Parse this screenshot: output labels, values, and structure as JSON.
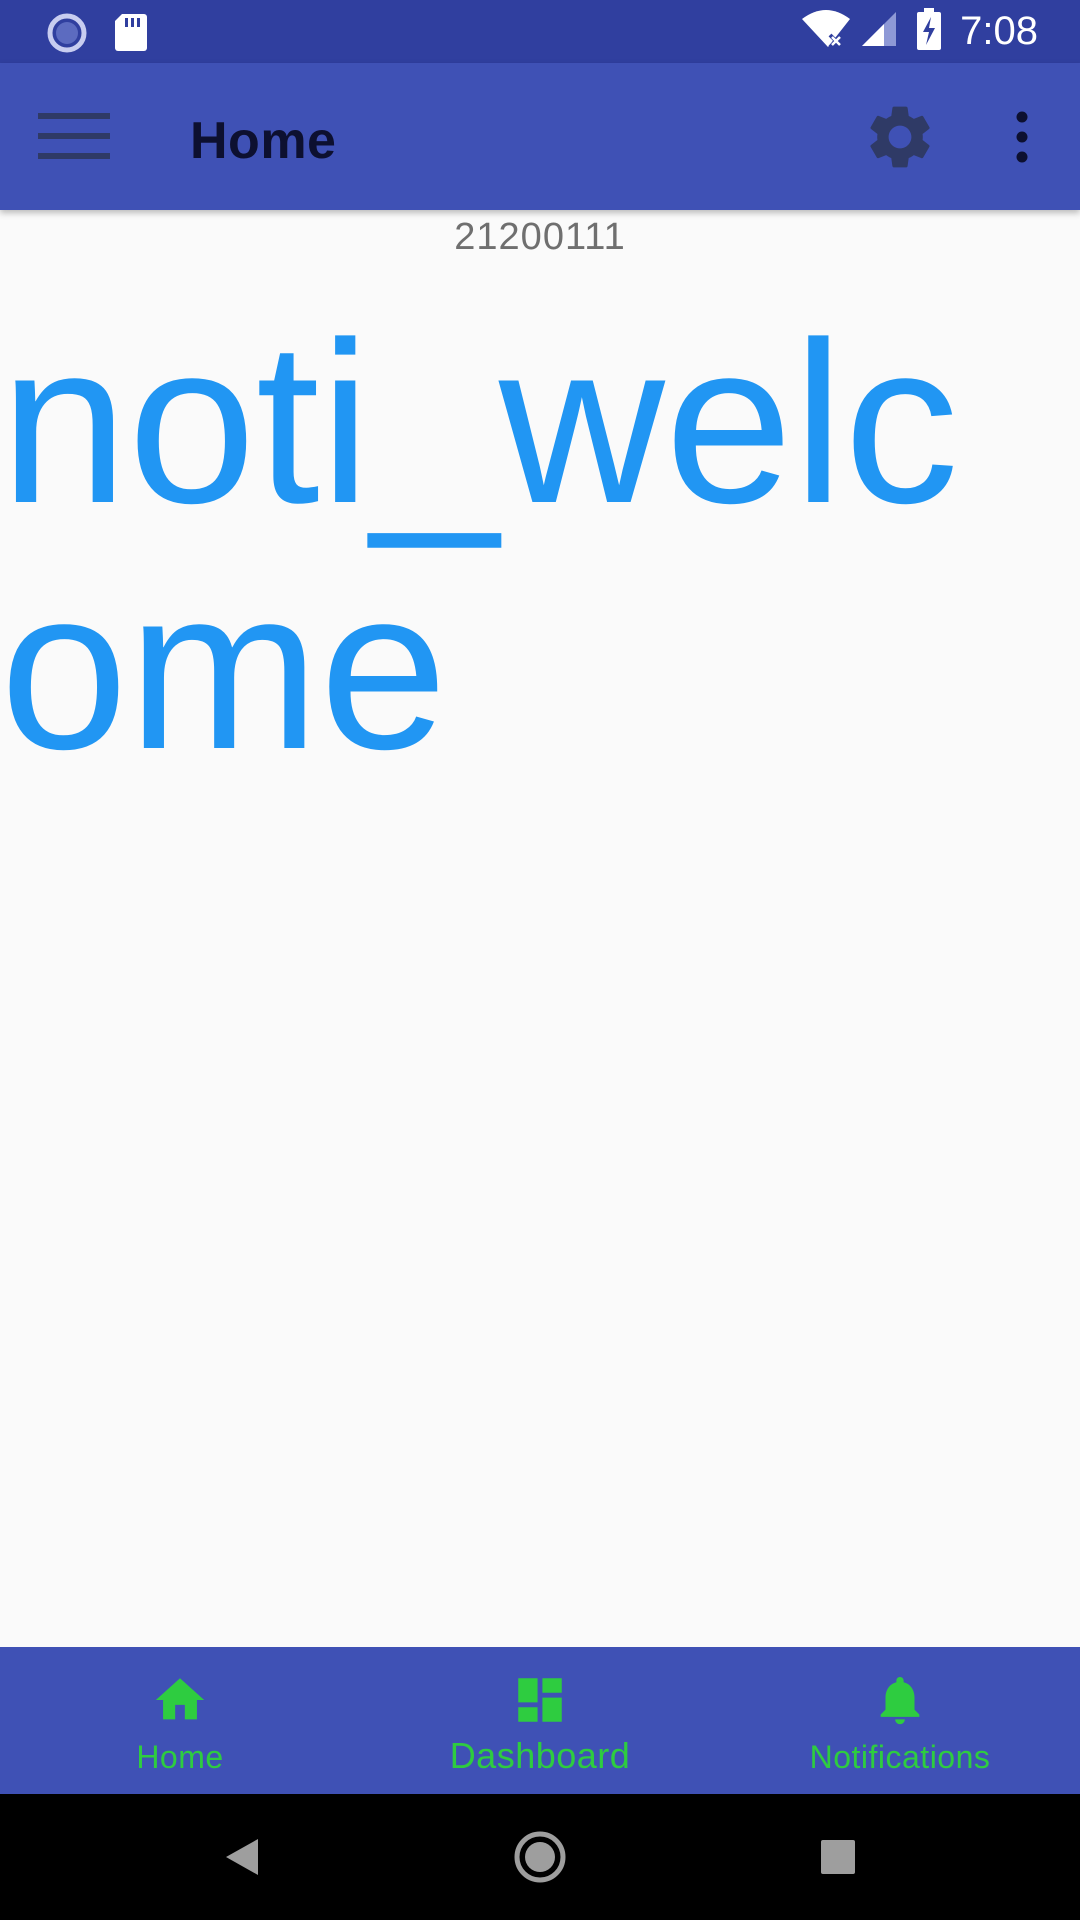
{
  "status_bar": {
    "time": "7:08"
  },
  "app_bar": {
    "title": "Home",
    "menu_icon": "hamburger-menu-icon",
    "settings_icon": "gear-icon",
    "overflow_icon": "more-vertical-icon"
  },
  "content": {
    "code": "21200111",
    "welcome": "noti_welcome"
  },
  "bottom_nav": {
    "items": [
      {
        "label": "Home",
        "icon": "home-icon"
      },
      {
        "label": "Dashboard",
        "icon": "dashboard-icon"
      },
      {
        "label": "Notifications",
        "icon": "bell-icon"
      }
    ],
    "selected": "Dashboard"
  },
  "colors": {
    "status_bar": "#303f9f",
    "app_bar": "#3f51b5",
    "accent_text": "#2196f3",
    "nav_label": "#2ecc40",
    "background": "#fafafa"
  }
}
